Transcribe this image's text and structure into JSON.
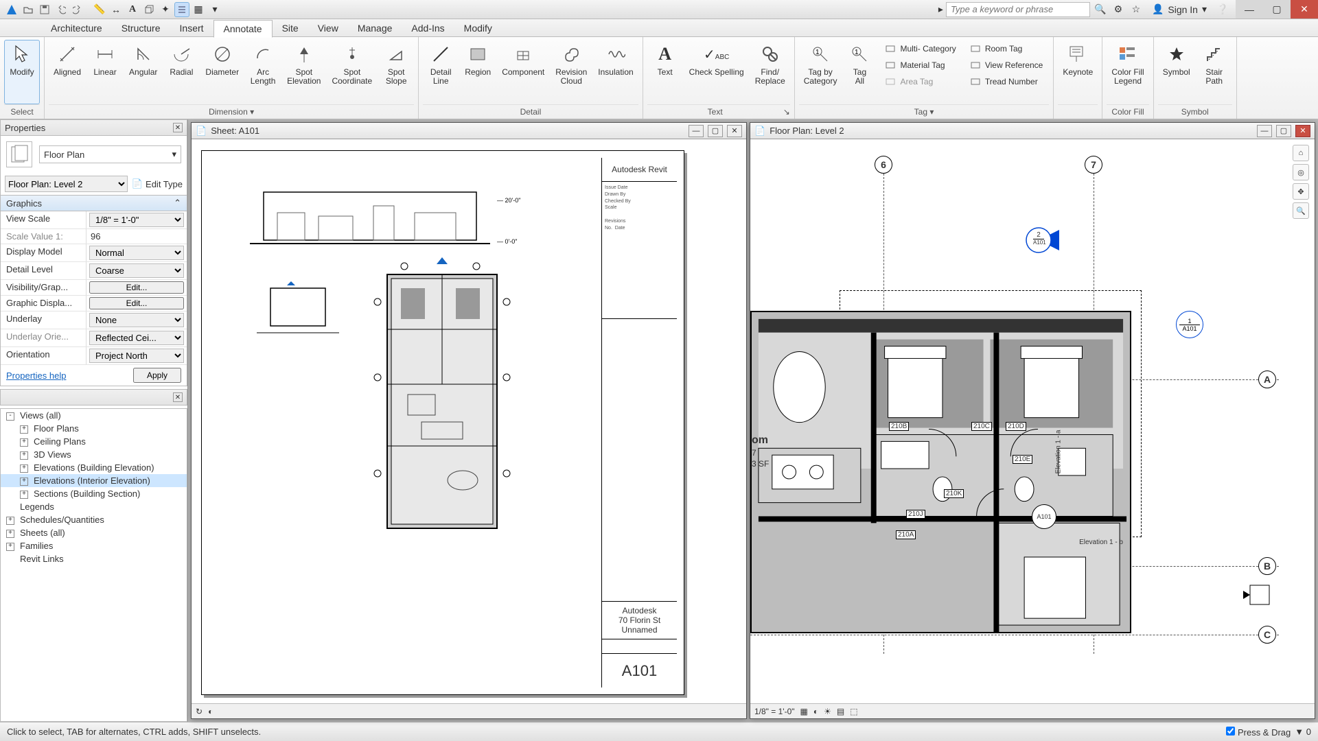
{
  "qat_search_placeholder": "Type a keyword or phrase",
  "signin_label": "Sign In",
  "menu": {
    "items": [
      "Architecture",
      "Structure",
      "Insert",
      "Annotate",
      "Site",
      "View",
      "Manage",
      "Add-Ins",
      "Modify"
    ],
    "active": "Annotate"
  },
  "ribbon": {
    "select": {
      "modify": "Modify",
      "label": "Select"
    },
    "dimension": {
      "items": [
        "Aligned",
        "Linear",
        "Angular",
        "Radial",
        "Diameter",
        "Arc\nLength",
        "Spot\nElevation",
        "Spot\nCoordinate",
        "Spot\nSlope"
      ],
      "label": "Dimension"
    },
    "detail": {
      "items": [
        "Detail\nLine",
        "Region",
        "Component",
        "Revision\nCloud",
        "Insulation"
      ],
      "label": "Detail"
    },
    "text": {
      "items": [
        "Text",
        "Check Spelling",
        "Find/\nReplace"
      ],
      "label": "Text"
    },
    "tag": {
      "big": [
        "Tag by\nCategory",
        "Tag\nAll"
      ],
      "small": [
        "Multi- Category",
        "Material  Tag",
        "Area  Tag",
        "Room  Tag",
        "View  Reference",
        "Tread  Number"
      ],
      "label": "Tag"
    },
    "keynote": {
      "item": "Keynote",
      "label": ""
    },
    "colorfill": {
      "item": "Color Fill\nLegend",
      "label": "Color Fill"
    },
    "symbol": {
      "items": [
        "Symbol",
        "Stair\nPath"
      ],
      "label": "Symbol"
    }
  },
  "properties": {
    "title": "Properties",
    "type": "Floor Plan",
    "instance": "Floor Plan: Level 2",
    "edit_type": "Edit Type",
    "section": "Graphics",
    "rows": [
      {
        "k": "View Scale",
        "v": "1/8\" = 1'-0\"",
        "ctrl": "select"
      },
      {
        "k": "Scale Value    1:",
        "v": "96",
        "ctrl": "text",
        "dim": true
      },
      {
        "k": "Display Model",
        "v": "Normal",
        "ctrl": "select"
      },
      {
        "k": "Detail Level",
        "v": "Coarse",
        "ctrl": "select"
      },
      {
        "k": "Visibility/Grap...",
        "v": "Edit...",
        "ctrl": "button"
      },
      {
        "k": "Graphic Displa...",
        "v": "Edit...",
        "ctrl": "button"
      },
      {
        "k": "Underlay",
        "v": "None",
        "ctrl": "select"
      },
      {
        "k": "Underlay Orie...",
        "v": "Reflected Cei...",
        "ctrl": "select",
        "dim": true
      },
      {
        "k": "Orientation",
        "v": "Project North",
        "ctrl": "select"
      }
    ],
    "help": "Properties help",
    "apply": "Apply"
  },
  "browser": {
    "items": [
      {
        "label": "Views (all)",
        "state": "expanded",
        "indent": 0
      },
      {
        "label": "Floor Plans",
        "state": "collapsed",
        "indent": 1
      },
      {
        "label": "Ceiling Plans",
        "state": "collapsed",
        "indent": 1
      },
      {
        "label": "3D Views",
        "state": "collapsed",
        "indent": 1
      },
      {
        "label": "Elevations (Building Elevation)",
        "state": "collapsed",
        "indent": 1
      },
      {
        "label": "Elevations (Interior Elevation)",
        "state": "collapsed",
        "indent": 1,
        "sel": true
      },
      {
        "label": "Sections (Building Section)",
        "state": "collapsed",
        "indent": 1
      },
      {
        "label": "Legends",
        "state": "leaf",
        "indent": 0
      },
      {
        "label": "Schedules/Quantities",
        "state": "collapsed",
        "indent": 0
      },
      {
        "label": "Sheets (all)",
        "state": "collapsed",
        "indent": 0
      },
      {
        "label": "Families",
        "state": "collapsed",
        "indent": 0
      },
      {
        "label": "Revit Links",
        "state": "leaf",
        "indent": 0
      }
    ]
  },
  "sheet_window": {
    "title": "Sheet: A101",
    "titleblock_title": "Autodesk Revit",
    "tb_company": "Autodesk",
    "tb_address": "70 Florin St",
    "tb_name": "Unnamed",
    "tb_number": "A101"
  },
  "plan_window": {
    "title": "Floor Plan: Level 2",
    "scale": "1/8\" = 1'-0\"",
    "grids_v": [
      "6",
      "7"
    ],
    "grids_h": [
      "A",
      "B",
      "C"
    ],
    "section_view": "2",
    "section_sheet": "A101",
    "callout_view": "1",
    "callout_sheet": "A101",
    "elev_label": "Elevation 1 - b",
    "elev_label2": "Elevation 1 - a",
    "room_label": "om",
    "detail_tag": "A101",
    "door_tags": [
      "210B",
      "210C",
      "210D",
      "210E",
      "210A",
      "210K",
      "210J"
    ]
  },
  "status": {
    "hint": "Click to select, TAB for alternates, CTRL adds, SHIFT unselects.",
    "pressdrag": "Press & Drag"
  }
}
